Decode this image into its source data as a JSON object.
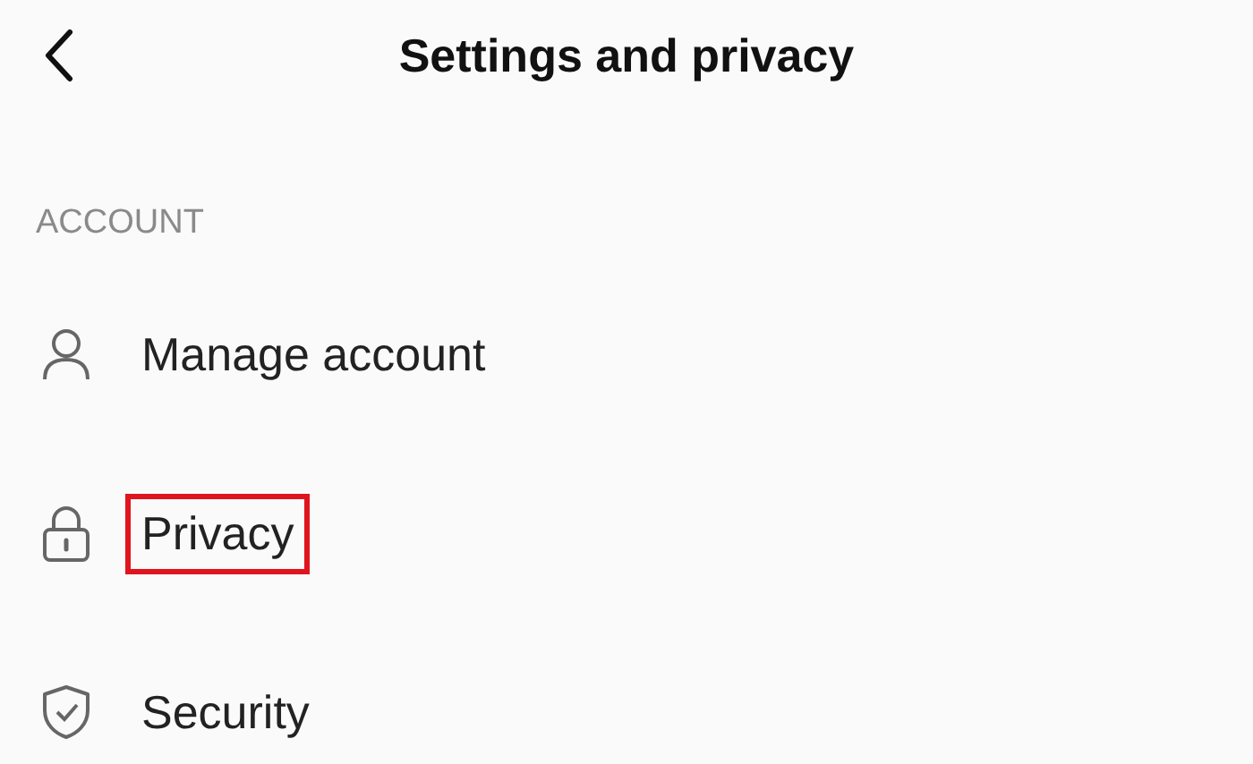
{
  "header": {
    "title": "Settings and privacy"
  },
  "section": {
    "title": "ACCOUNT",
    "items": [
      {
        "kind": "person",
        "label": "Manage account",
        "highlighted": false
      },
      {
        "kind": "lock",
        "label": "Privacy",
        "highlighted": true
      },
      {
        "kind": "shield",
        "label": "Security",
        "highlighted": false
      }
    ]
  }
}
